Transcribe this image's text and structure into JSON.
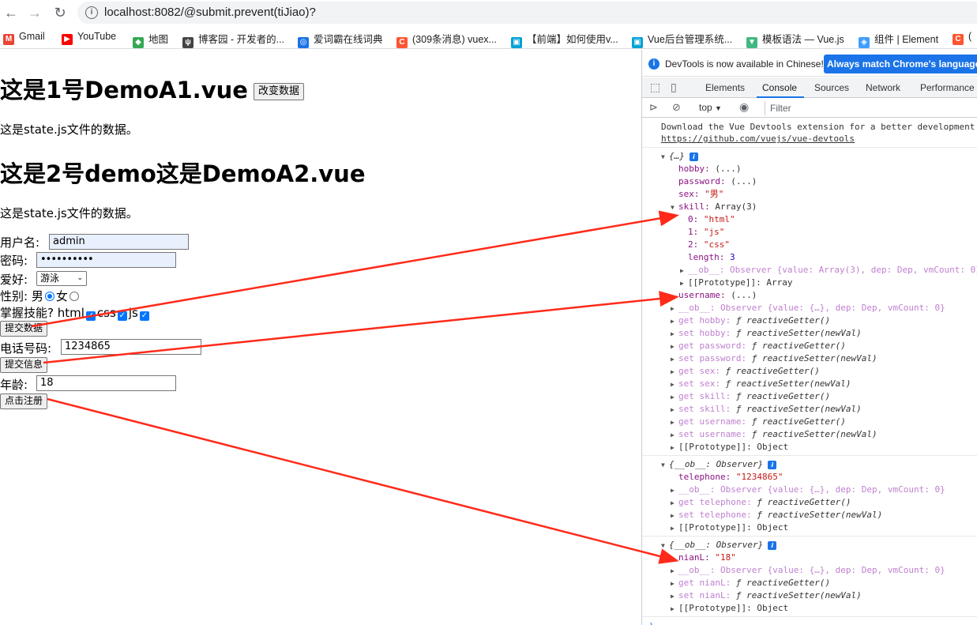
{
  "browser": {
    "url": "localhost:8082/@submit.prevent(tiJiao)?",
    "bookmarks": [
      {
        "label": "Gmail",
        "icon": "gmail-icon",
        "color": "#ea4335",
        "glyph": "M"
      },
      {
        "label": "YouTube",
        "icon": "youtube-icon",
        "color": "#ff0000",
        "glyph": "▶"
      },
      {
        "label": "地图",
        "icon": "maps-icon",
        "color": "#34a853",
        "glyph": "◆"
      },
      {
        "label": "博客园 - 开发者的...",
        "icon": "cnblogs-icon",
        "color": "#444444",
        "glyph": "ψ"
      },
      {
        "label": "爱词霸在线词典",
        "icon": "iciba-icon",
        "color": "#1a73e8",
        "glyph": "◎"
      },
      {
        "label": "(309条消息) vuex...",
        "icon": "csdn-icon",
        "color": "#fc5531",
        "glyph": "C"
      },
      {
        "label": "【前端】如何使用v...",
        "icon": "bilibili-icon",
        "color": "#00a1d6",
        "glyph": "▣"
      },
      {
        "label": "Vue后台管理系统...",
        "icon": "bilibili-icon",
        "color": "#00a1d6",
        "glyph": "▣"
      },
      {
        "label": "模板语法 — Vue.js",
        "icon": "vue-icon",
        "color": "#41b883",
        "glyph": "▼"
      },
      {
        "label": "组件 | Element",
        "icon": "element-icon",
        "color": "#409eff",
        "glyph": "◈"
      },
      {
        "label": "(",
        "icon": "csdn-icon",
        "color": "#fc5531",
        "glyph": "C"
      }
    ]
  },
  "page": {
    "h1a": "这是1号DemoA1.vue",
    "change_btn": "改变数据",
    "p1": "这是state.js文件的数据。",
    "h1b": "这是2号demo这是DemoA2.vue",
    "p2": "这是state.js文件的数据。",
    "username_label": "用户名:",
    "username_value": "admin",
    "password_label": "密码:",
    "password_value": "••••••••••",
    "hobby_label": "爱好:",
    "hobby_value": "游泳",
    "gender_label": "性别:",
    "gender_male": "男",
    "gender_female": "女",
    "skill_label": "掌握技能?",
    "skill_html": "html",
    "skill_css": "css",
    "skill_js": "js",
    "submit_data_btn": "提交数据",
    "phone_label": "电话号码:",
    "phone_value": "1234865",
    "submit_info_btn": "提交信息",
    "age_label": "年龄:",
    "age_value": "18",
    "register_btn": "点击注册"
  },
  "devtools": {
    "banner_text": "DevTools is now available in Chinese!",
    "banner_button": "Always match Chrome's language",
    "tabs": [
      "Elements",
      "Console",
      "Sources",
      "Network",
      "Performance"
    ],
    "active_tab": "Console",
    "context": "top",
    "filter_placeholder": "Filter",
    "console": {
      "download_msg": "Download the Vue Devtools extension for a better development",
      "devtools_link": "https://github.com/vuejs/vue-devtools",
      "obj1": {
        "header": "{…}",
        "hobby": "hobby:",
        "hobby_val": "(...)",
        "password": "password:",
        "password_val": "(...)",
        "sex": "sex:",
        "sex_val": "\"男\"",
        "skill": "skill:",
        "skill_val": "Array(3)",
        "skill_0k": "0:",
        "skill_0v": "\"html\"",
        "skill_1k": "1:",
        "skill_1v": "\"js\"",
        "skill_2k": "2:",
        "skill_2v": "\"css\"",
        "length_k": "length:",
        "length_v": "3",
        "arr_ob": "__ob__: Observer {value: Array(3), dep: Dep, vmCount: 0}",
        "arr_proto": "[[Prototype]]: Array",
        "username": "username:",
        "username_val": "(...)",
        "ob": "__ob__: Observer {value: {…}, dep: Dep, vmCount: 0}",
        "accessors": [
          {
            "k": "get hobby:",
            "v": "ƒ reactiveGetter()"
          },
          {
            "k": "set hobby:",
            "v": "ƒ reactiveSetter(newVal)"
          },
          {
            "k": "get password:",
            "v": "ƒ reactiveGetter()"
          },
          {
            "k": "set password:",
            "v": "ƒ reactiveSetter(newVal)"
          },
          {
            "k": "get sex:",
            "v": "ƒ reactiveGetter()"
          },
          {
            "k": "set sex:",
            "v": "ƒ reactiveSetter(newVal)"
          },
          {
            "k": "get skill:",
            "v": "ƒ reactiveGetter()"
          },
          {
            "k": "set skill:",
            "v": "ƒ reactiveSetter(newVal)"
          },
          {
            "k": "get username:",
            "v": "ƒ reactiveGetter()"
          },
          {
            "k": "set username:",
            "v": "ƒ reactiveSetter(newVal)"
          }
        ],
        "proto": "[[Prototype]]: Object"
      },
      "obj2": {
        "header": "{__ob__: Observer}",
        "telephone": "telephone:",
        "telephone_val": "\"1234865\"",
        "ob": "__ob__: Observer {value: {…}, dep: Dep, vmCount: 0}",
        "get": "get telephone:",
        "get_val": "ƒ reactiveGetter()",
        "set": "set telephone:",
        "set_val": "ƒ reactiveSetter(newVal)",
        "proto": "[[Prototype]]: Object"
      },
      "obj3": {
        "header": "{__ob__: Observer}",
        "nianL": "nianL:",
        "nianL_val": "\"18\"",
        "ob": "__ob__: Observer {value: {…}, dep: Dep, vmCount: 0}",
        "get": "get nianL:",
        "get_val": "ƒ reactiveGetter()",
        "set": "set nianL:",
        "set_val": "ƒ reactiveSetter(newVal)",
        "proto": "[[Prototype]]: Object"
      }
    }
  },
  "annotation_color": "#ff2a1a"
}
